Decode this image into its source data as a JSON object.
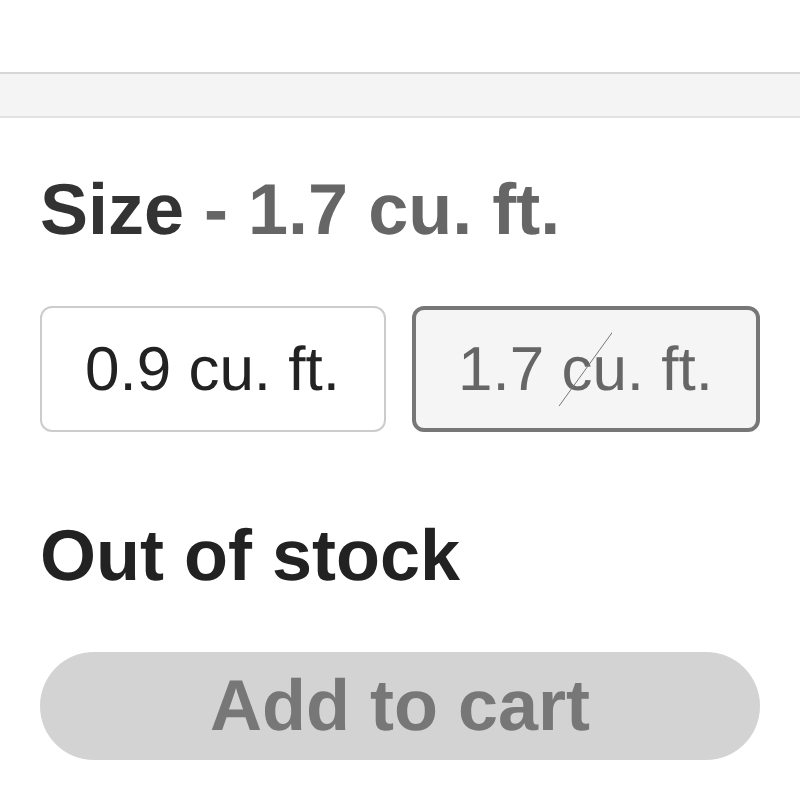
{
  "size": {
    "label": "Size",
    "value": "- 1.7 cu. ft."
  },
  "options": [
    {
      "label": "0.9 cu. ft.",
      "selected": false,
      "available": true
    },
    {
      "label": "1.7 cu. ft.",
      "selected": true,
      "available": false
    }
  ],
  "stock_status": "Out of stock",
  "add_to_cart": {
    "label": "Add to cart",
    "disabled": true
  }
}
